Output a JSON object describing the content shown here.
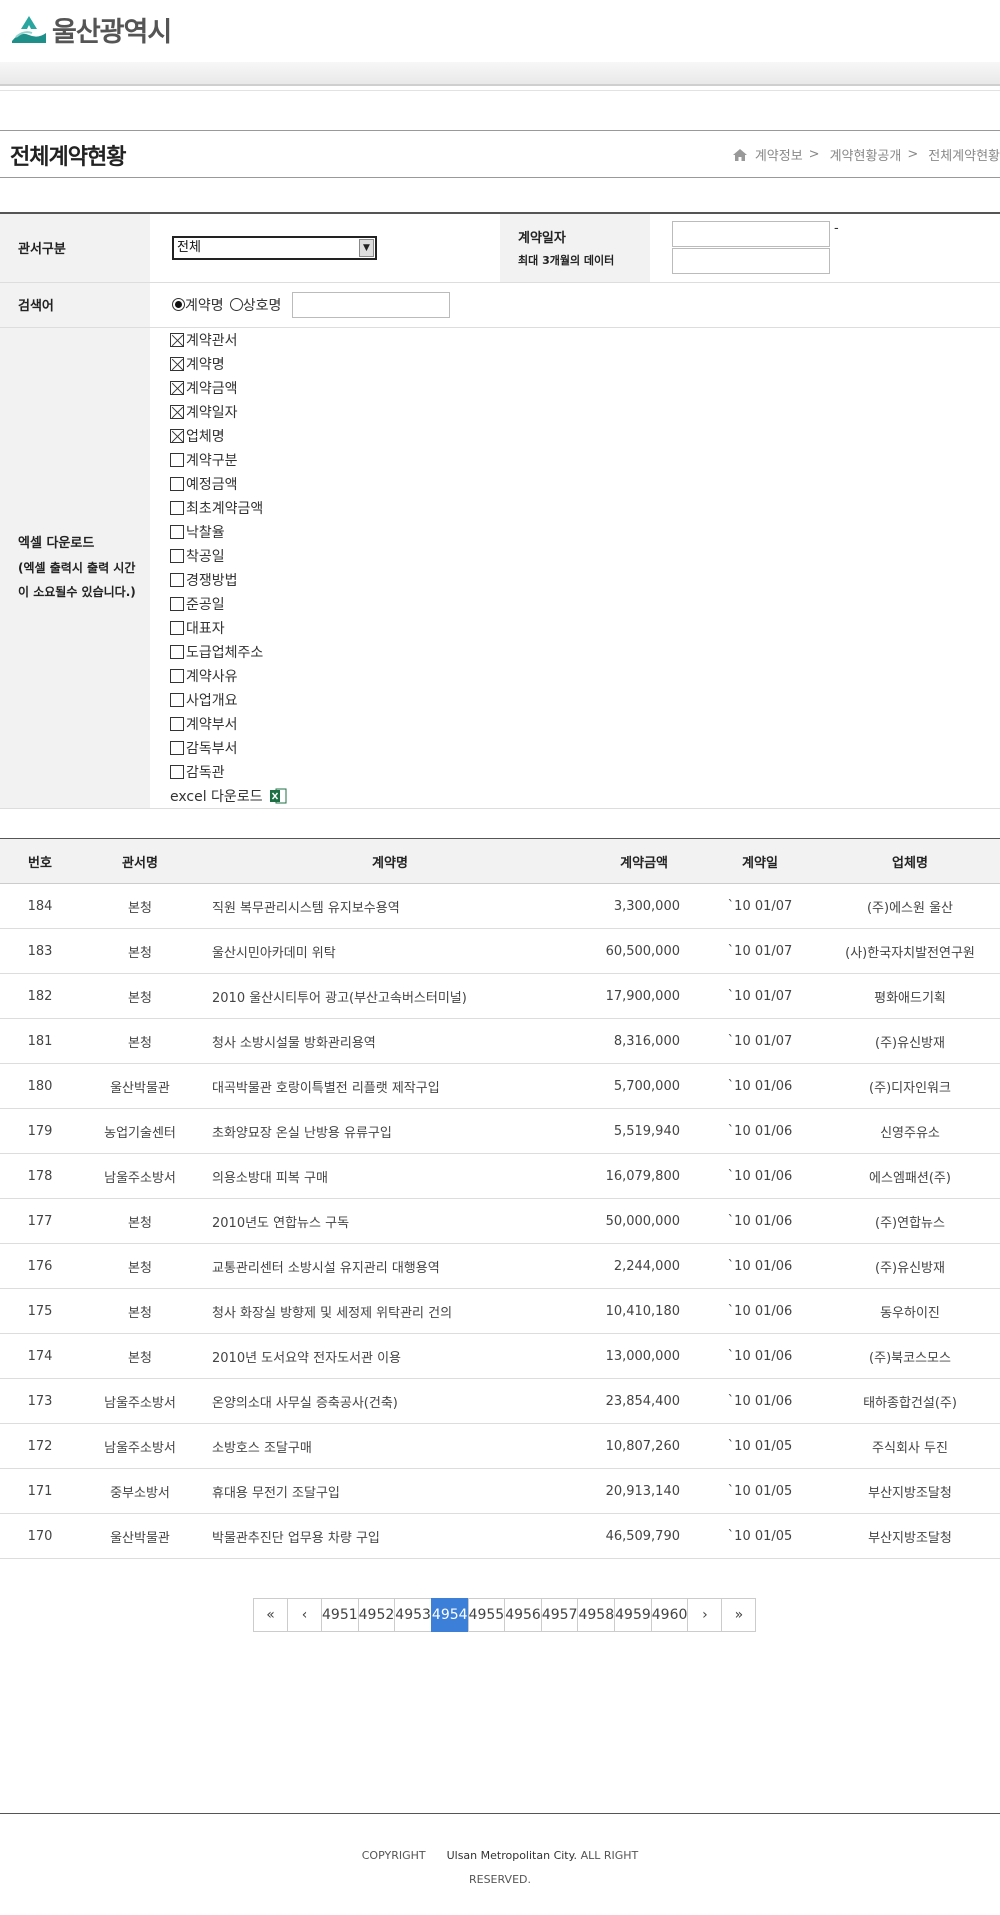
{
  "brand": {
    "logo_text": "울산광역시"
  },
  "page": {
    "title": "전체계약현황"
  },
  "breadcrumb": [
    "계약정보",
    "계약현황공개",
    "전체계약현황"
  ],
  "search": {
    "dept_label": "관서구분",
    "dept_value": "전체",
    "date_label": "계약일자",
    "date_note": "최대 3개월의 데이터",
    "date_from": "",
    "date_to": "",
    "date_sep": "-",
    "keyword_label": "검색어",
    "radio_contract": "계약명",
    "radio_company": "상호명",
    "keyword_value": ""
  },
  "excel": {
    "label_line1": "엑셀 다운로드",
    "label_line2": "(엑셀 출력시 출력 시간",
    "label_line3": "이 소요될수 있습니다.)",
    "download_label": "excel 다운로드",
    "fields": [
      {
        "label": "계약관서",
        "checked": true
      },
      {
        "label": "계약명",
        "checked": true
      },
      {
        "label": "계약금액",
        "checked": true
      },
      {
        "label": "계약일자",
        "checked": true
      },
      {
        "label": "업체명",
        "checked": true
      },
      {
        "label": "계약구분",
        "checked": false
      },
      {
        "label": "예정금액",
        "checked": false
      },
      {
        "label": "최초계약금액",
        "checked": false
      },
      {
        "label": "낙찰율",
        "checked": false
      },
      {
        "label": "착공일",
        "checked": false
      },
      {
        "label": "경쟁방법",
        "checked": false
      },
      {
        "label": "준공일",
        "checked": false
      },
      {
        "label": "대표자",
        "checked": false
      },
      {
        "label": "도급업체주소",
        "checked": false
      },
      {
        "label": "계약사유",
        "checked": false
      },
      {
        "label": "사업개요",
        "checked": false
      },
      {
        "label": "계약부서",
        "checked": false
      },
      {
        "label": "감독부서",
        "checked": false
      },
      {
        "label": "감독관",
        "checked": false
      }
    ]
  },
  "table": {
    "headers": [
      "번호",
      "관서명",
      "계약명",
      "계약금액",
      "계약일",
      "업체명"
    ],
    "rows": [
      [
        "184",
        "본청",
        "직원 복무관리시스템 유지보수용역",
        "3,300,000",
        "`10 01/07",
        "(주)에스원 울산"
      ],
      [
        "183",
        "본청",
        "울산시민아카데미 위탁",
        "60,500,000",
        "`10 01/07",
        "(사)한국자치발전연구원"
      ],
      [
        "182",
        "본청",
        "2010 울산시티투어 광고(부산고속버스터미널)",
        "17,900,000",
        "`10 01/07",
        "평화애드기획"
      ],
      [
        "181",
        "본청",
        "청사 소방시설물 방화관리용역",
        "8,316,000",
        "`10 01/07",
        "(주)유신방재"
      ],
      [
        "180",
        "울산박물관",
        "대곡박물관 호랑이특별전 리플랫 제작구입",
        "5,700,000",
        "`10 01/06",
        "(주)디자인워크"
      ],
      [
        "179",
        "농업기술센터",
        "초화양묘장 온실 난방용 유류구입",
        "5,519,940",
        "`10 01/06",
        "신영주유소"
      ],
      [
        "178",
        "남울주소방서",
        "의용소방대 피복 구매",
        "16,079,800",
        "`10 01/06",
        "에스엠패션(주)"
      ],
      [
        "177",
        "본청",
        "2010년도 연합뉴스 구독",
        "50,000,000",
        "`10 01/06",
        "(주)연합뉴스"
      ],
      [
        "176",
        "본청",
        "교통관리센터 소방시설 유지관리 대행용역",
        "2,244,000",
        "`10 01/06",
        "(주)유신방재"
      ],
      [
        "175",
        "본청",
        "청사 화장실 방향제 및 세정제 위탁관리 건의",
        "10,410,180",
        "`10 01/06",
        "동우하이진"
      ],
      [
        "174",
        "본청",
        "2010년 도서요약 전자도서관 이용",
        "13,000,000",
        "`10 01/06",
        "(주)북코스모스"
      ],
      [
        "173",
        "남울주소방서",
        "온양의소대 사무실 증축공사(건축)",
        "23,854,400",
        "`10 01/06",
        "태하종합건설(주)"
      ],
      [
        "172",
        "남울주소방서",
        "소방호스 조달구매",
        "10,807,260",
        "`10 01/05",
        "주식회사 두진"
      ],
      [
        "171",
        "중부소방서",
        "휴대용 무전기 조달구입",
        "20,913,140",
        "`10 01/05",
        "부산지방조달청"
      ],
      [
        "170",
        "울산박물관",
        "박물관추진단 업무용 차량 구입",
        "46,509,790",
        "`10 01/05",
        "부산지방조달청"
      ]
    ]
  },
  "pagination": {
    "first": "«",
    "prev": "‹",
    "pages": [
      "4951",
      "4952",
      "4953",
      "4954",
      "4955",
      "4956",
      "4957",
      "4958",
      "4959",
      "4960"
    ],
    "current": "4954",
    "next": "›",
    "last": "»"
  },
  "footer": {
    "copyright": "COPYRIGHT",
    "org": "Ulsan Metropolitan City.",
    "rights_1": "ALL RIGHT",
    "rights_2": "RESERVED."
  }
}
